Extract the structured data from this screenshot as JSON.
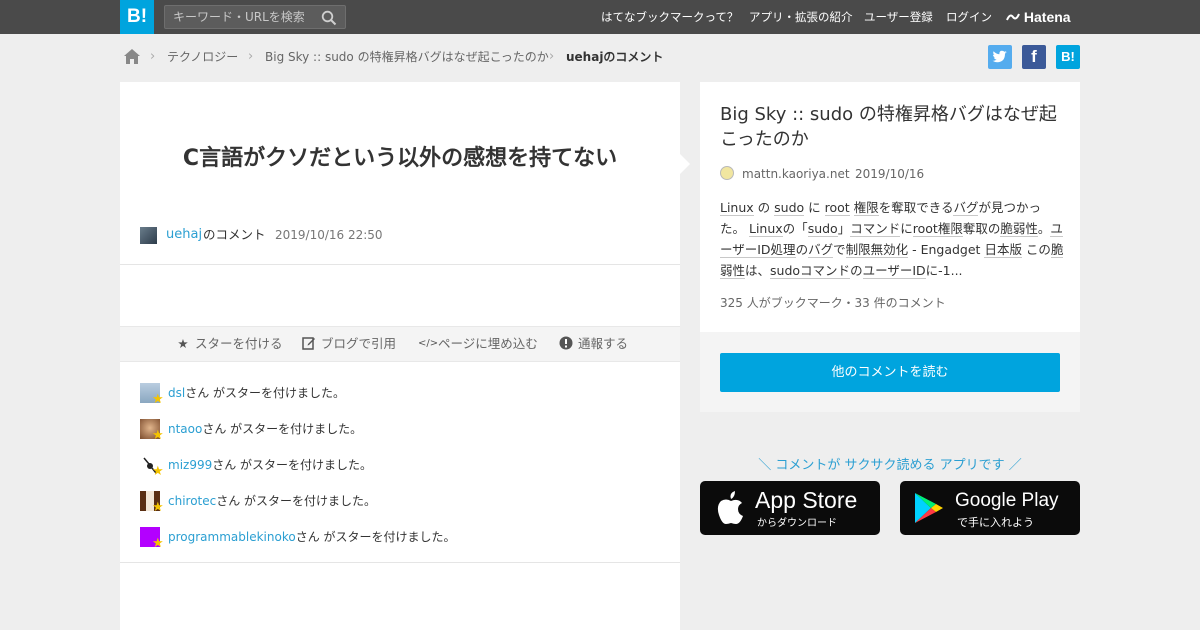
{
  "header": {
    "logo_text": "B!",
    "search_placeholder": "キーワード・URLを検索",
    "nav": [
      "はてなブックマークって？",
      "アプリ・拡張の紹介",
      "ユーザー登録",
      "ログイン"
    ],
    "hatena_label": "Hatena"
  },
  "breadcrumb": {
    "items": [
      "テクノロジー",
      "Big Sky :: sudo の特権昇格バグはなぜ起こったのか"
    ],
    "current": "uehajのコメント"
  },
  "share": {
    "hatena_label": "B!"
  },
  "comment": {
    "text": "C言語がクソだという以外の感想を持てない",
    "user": "uehaj",
    "user_suffix": "のコメント",
    "timestamp": "2019/10/16 22:50"
  },
  "actions": [
    {
      "icon": "star-icon",
      "label": "スターを付ける"
    },
    {
      "icon": "edit-icon",
      "label": "ブログで引用"
    },
    {
      "icon": "code-icon",
      "label": "ページに埋め込む"
    },
    {
      "icon": "alert-icon",
      "label": "通報する"
    }
  ],
  "stars": {
    "suffix": "さん がスターを付けました。",
    "users": [
      "dsl",
      "ntaoo",
      "miz999",
      "chirotec",
      "programmablekinoko"
    ]
  },
  "entry": {
    "title": "Big Sky :: sudo の特権昇格バグはなぜ起こったのか",
    "site": "mattn.kaoriya.net",
    "date": "2019/10/16",
    "summary": [
      {
        "t": "Linux",
        "k": true
      },
      {
        "t": " の ",
        "k": false
      },
      {
        "t": "sudo",
        "k": true
      },
      {
        "t": " に ",
        "k": false
      },
      {
        "t": "root",
        "k": true
      },
      {
        "t": " ",
        "k": false
      },
      {
        "t": "権限",
        "k": true
      },
      {
        "t": "を奪取できる",
        "k": false
      },
      {
        "t": "バグ",
        "k": true
      },
      {
        "t": "が見つかった。 ",
        "k": false
      },
      {
        "t": "Linux",
        "k": true
      },
      {
        "t": "の「",
        "k": false
      },
      {
        "t": "sudo",
        "k": true
      },
      {
        "t": "」",
        "k": false
      },
      {
        "t": "コマンド",
        "k": true
      },
      {
        "t": "に",
        "k": false
      },
      {
        "t": "root権限",
        "k": true
      },
      {
        "t": "奪取の",
        "k": false
      },
      {
        "t": "脆弱性",
        "k": true
      },
      {
        "t": "。",
        "k": false
      },
      {
        "t": "ユーザーID処理",
        "k": true
      },
      {
        "t": "の",
        "k": false
      },
      {
        "t": "バグ",
        "k": true
      },
      {
        "t": "で",
        "k": false
      },
      {
        "t": "制限無効化",
        "k": true
      },
      {
        "t": " - Engadget ",
        "k": false
      },
      {
        "t": "日本版",
        "k": true
      },
      {
        "t": " この",
        "k": false
      },
      {
        "t": "脆弱性",
        "k": true
      },
      {
        "t": "は、",
        "k": false
      },
      {
        "t": "sudoコマンド",
        "k": true
      },
      {
        "t": "の",
        "k": false
      },
      {
        "t": "ユーザーID",
        "k": true
      },
      {
        "t": "に-1...",
        "k": false
      }
    ],
    "counts": "325 人がブックマーク・33 件のコメント",
    "read_button": "他のコメントを読む"
  },
  "promo": {
    "text": "＼ コメントが サクサク読める アプリです ／",
    "appstore_big": "App Store",
    "appstore_small": "からダウンロード",
    "googleplay_big": "Google Play",
    "googleplay_small": "で手に入れよう"
  },
  "colors": {
    "brand": "#00a4de",
    "link": "#2b9fd2",
    "star": "#f5c400"
  }
}
